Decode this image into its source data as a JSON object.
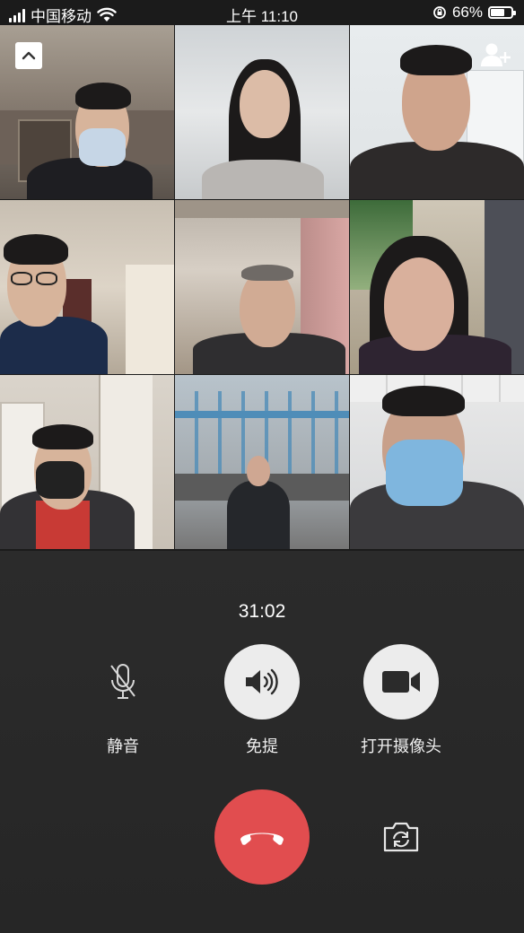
{
  "status_bar": {
    "carrier": "中国移动",
    "time": "上午 11:10",
    "battery": "66%",
    "battery_level": 0.66
  },
  "call": {
    "timer": "31:02",
    "controls": {
      "mute_label": "静音",
      "speaker_label": "免提",
      "camera_label": "打开摄像头"
    },
    "participant_count": 9
  },
  "icons": {
    "collapse": "chevron-up-icon",
    "add_member": "add-person-icon",
    "mute": "microphone-off-icon",
    "speaker": "speaker-icon",
    "camera": "video-camera-icon",
    "hangup": "phone-hangup-icon",
    "flip": "flip-camera-icon"
  },
  "colors": {
    "hangup": "#e14d4f",
    "background": "#2b2b2b",
    "control_active": "#ececec"
  }
}
